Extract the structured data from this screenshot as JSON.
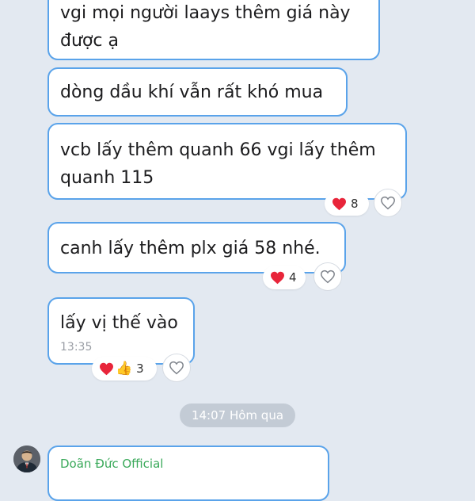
{
  "messages": [
    {
      "text": "vgi mọi người laays thêm giá này\nđược ạ"
    },
    {
      "text": "dòng dầu khí vẫn rất khó mua"
    },
    {
      "text": "vcb lấy thêm quanh 66 vgi lấy thêm\nquanh 115",
      "reaction_count": "8"
    },
    {
      "text": "canh lấy thêm plx giá 58 nhé.",
      "reaction_count": "4"
    },
    {
      "text": "lấy vị thế vào",
      "time": "13:35",
      "reaction_count": "3"
    }
  ],
  "timestamp_divider": "14:07 Hôm qua",
  "next_message": {
    "sender": "Doãn Đức Official"
  },
  "icons": {
    "reaction": "heart-icon",
    "reaction_like": "thumbs-up-icon",
    "react_button": "heart-outline-icon"
  },
  "colors": {
    "bubble_border": "#5aa3ea",
    "background": "#e3e9f1",
    "heart": "#e8253a",
    "sender_name": "#3aa95a",
    "divider_bg": "#c3cbd5"
  }
}
